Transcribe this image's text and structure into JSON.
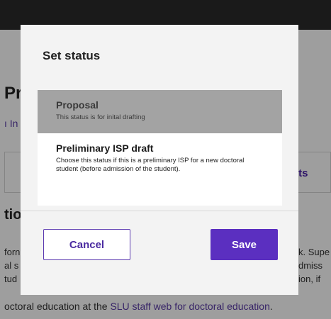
{
  "background": {
    "title_fragment": "Pr",
    "link_fragment": "ı In",
    "tab_fragment": "nts",
    "section_fragment": "tio",
    "left_text_lines": [
      "forn",
      "al s",
      "tud"
    ],
    "right_text_lines": [
      "k. Supe",
      "dmiss",
      "ion, if"
    ],
    "footer_prefix": "octoral education at the ",
    "footer_link": "SLU staff web for doctoral education",
    "footer_suffix": "."
  },
  "modal": {
    "title": "Set status",
    "options": [
      {
        "label": "Proposal",
        "description": "This status is for inital drafting",
        "selected": true
      },
      {
        "label": "Preliminary ISP draft",
        "description": "Choose this status if this is a preliminary ISP for a new doctoral student (before admission of the student).",
        "selected": false
      }
    ],
    "cancel_label": "Cancel",
    "save_label": "Save"
  },
  "colors": {
    "accent": "#5b2fc0",
    "selected_option": "#a3a3a3",
    "topbar": "#2b2b2b"
  }
}
